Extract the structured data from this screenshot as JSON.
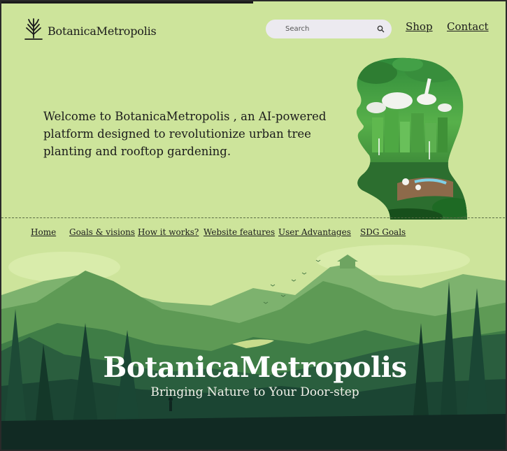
{
  "header": {
    "brand": "BotanicaMetropolis",
    "search_placeholder": "Search",
    "links": [
      "Shop",
      "Contact"
    ]
  },
  "intro": {
    "text": "Welcome to BotanicaMetropolis , an AI-powered platform designed to revolutionize urban tree planting and rooftop gardening."
  },
  "nav": {
    "items": [
      "Home",
      "Goals & visions",
      "How it works?",
      "Website features",
      "User Advantages",
      "SDG Goals"
    ]
  },
  "hero": {
    "title": "BotanicaMetropolis",
    "subtitle": "Bringing Nature to Your Door-step"
  },
  "colors": {
    "background": "#cde49b",
    "text": "#1b1b1b",
    "forest_dark": "#123129",
    "search_bg": "#eceaf0"
  }
}
